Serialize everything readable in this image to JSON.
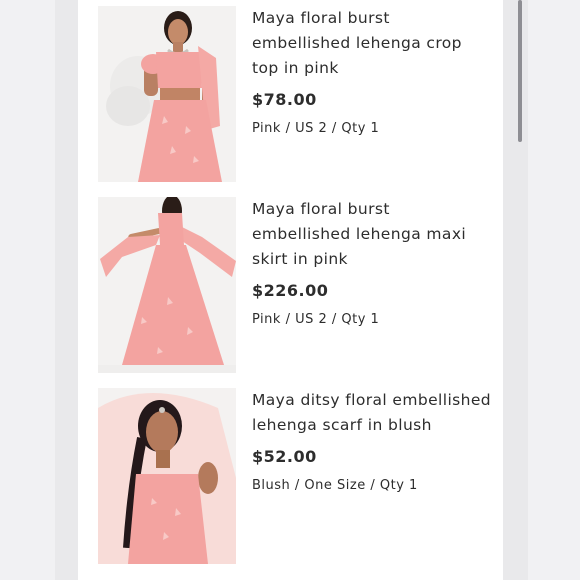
{
  "items": [
    {
      "title": "Maya floral burst embellished lehenga crop top in pink",
      "price": "$78.00",
      "meta": "Pink / US 2 / Qty 1",
      "image_icon": "product-photo-crop-top"
    },
    {
      "title": "Maya floral burst embellished lehenga maxi skirt in pink",
      "price": "$226.00",
      "meta": "Pink / US 2 / Qty 1",
      "image_icon": "product-photo-maxi-skirt"
    },
    {
      "title": "Maya ditsy floral embellished lehenga scarf in blush",
      "price": "$52.00",
      "meta": "Blush / One Size / Qty 1",
      "image_icon": "product-photo-scarf"
    }
  ],
  "colors": {
    "background": "#e9e9eb",
    "card": "#ffffff",
    "text": "#2d2d2d",
    "garment_pink": "#f3a3a0",
    "scrollbar": "#8e8e93"
  }
}
